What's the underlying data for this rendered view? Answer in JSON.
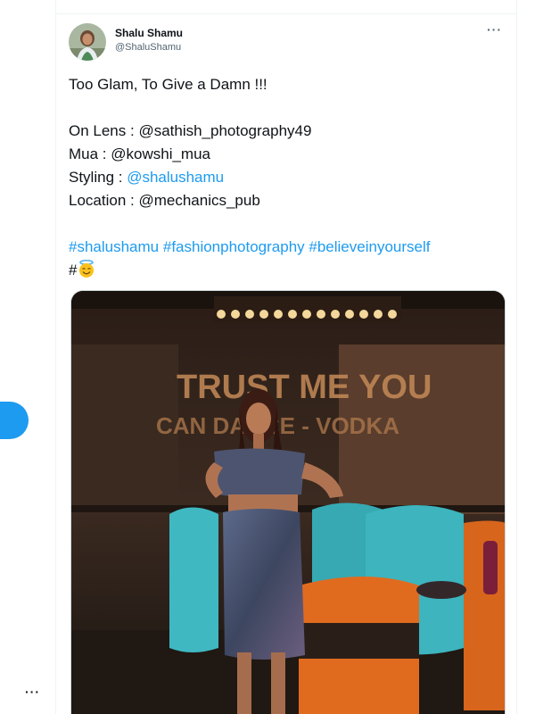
{
  "sidebar": {
    "more_label": "···"
  },
  "tweet": {
    "author": {
      "display_name": "Shalu Shamu",
      "handle": "@ShaluShamu"
    },
    "more_options": "···",
    "lines": {
      "headline": "Too Glam, To Give a Damn !!!",
      "lens_prefix": "On Lens : ",
      "lens_value": "@sathish_photography49",
      "mua_prefix": "Mua : ",
      "mua_value": "@kowshi_mua",
      "styling_prefix": "Styling : ",
      "styling_link": "@shalushamu",
      "location_prefix": "Location : ",
      "location_value": "@mechanics_pub",
      "hashtag_1": "#shalushamu",
      "hashtag_2": "#fashionphotography",
      "hashtag_3": "#believeinyourself",
      "hash_symbol": "#"
    },
    "emoji_icon": "smiling-face-with-halo-icon",
    "media": {
      "photo_wall_text_top": "TRUST ME YOU",
      "photo_wall_text_bottom": "CAN DANCE - VODKA"
    }
  },
  "colors": {
    "link": "#1d9bf0",
    "text": "#0f1419",
    "muted": "#536471",
    "accent_button": "#1d9bf0"
  }
}
